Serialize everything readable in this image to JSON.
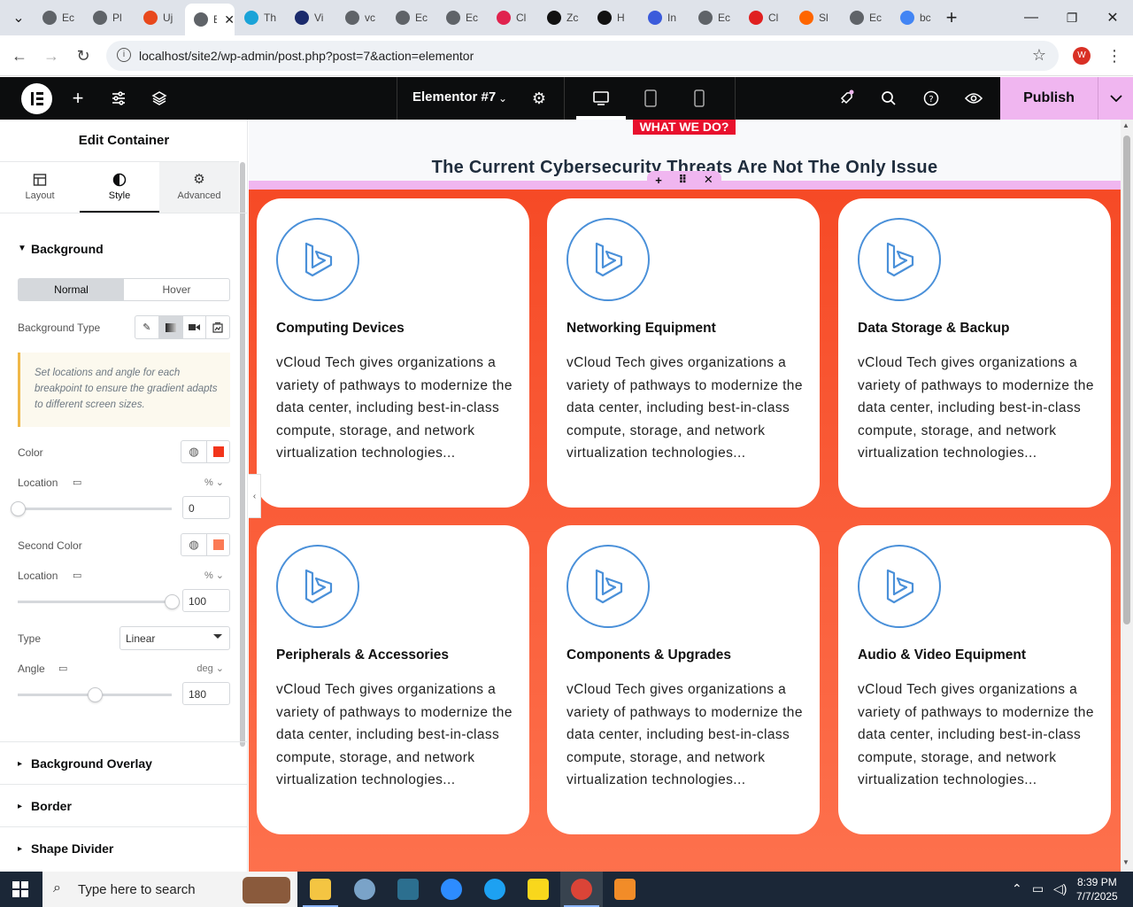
{
  "browser": {
    "tabs": [
      {
        "label": "Ec",
        "color": "#5f6368"
      },
      {
        "label": "Pl",
        "color": "#5f6368"
      },
      {
        "label": "Uj",
        "color": "#e8481c"
      },
      {
        "label": "Ec",
        "color": "#5f6368",
        "active": true
      },
      {
        "label": "Th",
        "color": "#1aa3d8"
      },
      {
        "label": "Vi",
        "color": "#1a2a6c"
      },
      {
        "label": "vc",
        "color": "#5f6368"
      },
      {
        "label": "Ec",
        "color": "#5f6368"
      },
      {
        "label": "Ec",
        "color": "#5f6368"
      },
      {
        "label": "Cl",
        "color": "#e0234e"
      },
      {
        "label": "Zc",
        "color": "#111111"
      },
      {
        "label": "H",
        "color": "#111111"
      },
      {
        "label": "In",
        "color": "#3b5bdb"
      },
      {
        "label": "Ec",
        "color": "#5f6368"
      },
      {
        "label": "Cl",
        "color": "#e02020"
      },
      {
        "label": "Sl",
        "color": "#ff6600"
      },
      {
        "label": "Ec",
        "color": "#5f6368"
      },
      {
        "label": "bc",
        "color": "#4285f4"
      }
    ],
    "url": "localhost/site2/wp-admin/post.php?post=7&action=elementor",
    "profile_initial": "W"
  },
  "topbar": {
    "doc_title": "Elementor #7",
    "publish_label": "Publish"
  },
  "panel": {
    "title": "Edit Container",
    "tabs": [
      "Layout",
      "Style",
      "Advanced"
    ],
    "background_section": "Background",
    "state_normal": "Normal",
    "state_hover": "Hover",
    "bg_type_label": "Background Type",
    "notice": "Set locations and angle for each breakpoint to ensure the gradient adapts to different screen sizes.",
    "color_label": "Color",
    "color_value": "#f2351b",
    "location_label": "Location",
    "location_unit": "%",
    "location1_value": "0",
    "second_color_label": "Second Color",
    "second_color_value": "#fb7a55",
    "location2_value": "100",
    "type_label": "Type",
    "type_value": "Linear",
    "angle_label": "Angle",
    "angle_unit": "deg",
    "angle_value": "180",
    "sections": [
      "Background Overlay",
      "Border",
      "Shape Divider"
    ]
  },
  "canvas": {
    "eyebrow": "WHAT WE DO?",
    "heading": "The Current Cybersecurity Threats Are Not The Only Issue",
    "cards": [
      {
        "title": "Computing Devices",
        "body": "vCloud Tech gives organizations a variety of pathways to modernize the data center, including best-in-class compute, storage, and network virtualization technologies..."
      },
      {
        "title": "Networking Equipment",
        "body": "vCloud Tech gives organizations a variety of pathways to modernize the data center, including best-in-class compute, storage, and network virtualization technologies..."
      },
      {
        "title": "Data Storage & Backup",
        "body": "vCloud Tech gives organizations a variety of pathways to modernize the data center, including best-in-class compute, storage, and network virtualization technologies..."
      },
      {
        "title": "Peripherals & Accessories",
        "body": "vCloud Tech gives organizations a variety of pathways to modernize the data center, including best-in-class compute, storage, and network virtualization technologies..."
      },
      {
        "title": "Components & Upgrades",
        "body": "vCloud Tech gives organizations a variety of pathways to modernize the data center, including best-in-class compute, storage, and network virtualization technologies..."
      },
      {
        "title": "Audio & Video Equipment",
        "body": "vCloud Tech gives organizations a variety of pathways to modernize the data center, including best-in-class compute, storage, and network virtualization technologies..."
      }
    ]
  },
  "taskbar": {
    "search_placeholder": "Type here to search",
    "time": "8:39 PM",
    "date": "7/7/2025"
  }
}
